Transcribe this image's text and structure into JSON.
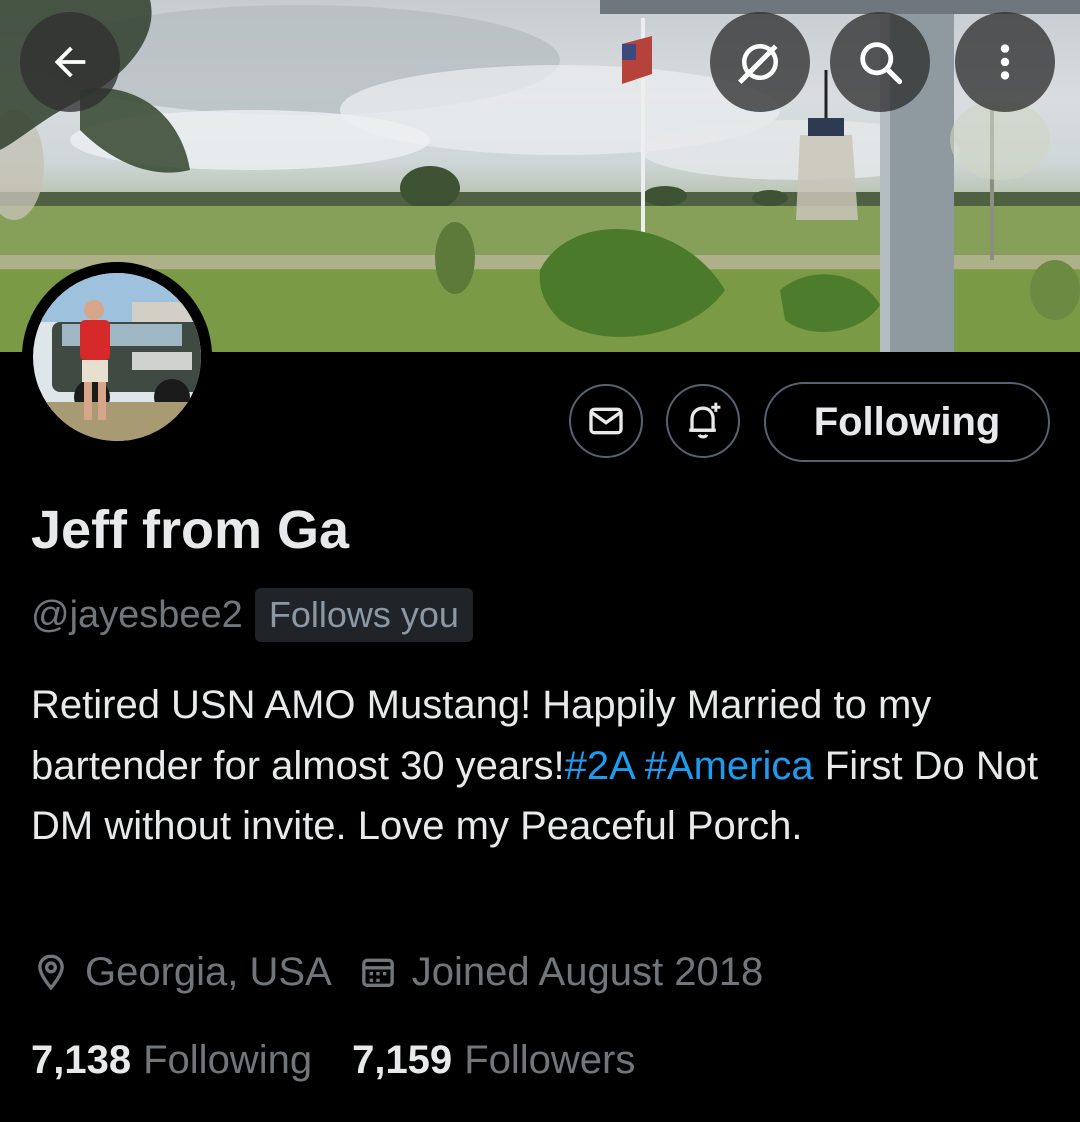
{
  "banner": {
    "description_icon": "banner-image"
  },
  "top_bar": {
    "back_icon": "arrow-left-icon",
    "grok_icon": "grok-icon",
    "search_icon": "search-icon",
    "more_icon": "more-vertical-icon"
  },
  "profile": {
    "display_name": "Jeff from Ga",
    "handle": "@jayesbee2",
    "follows_you_badge": "Follows you",
    "bio_part1": "Retired USN AMO Mustang! Happily Married to my bartender for almost 30 years!",
    "hashtag1": "#2A",
    "hashtag2": "#America",
    "bio_part2": "First Do Not DM without invite. Love my Peaceful Porch.",
    "location": "Georgia, USA",
    "joined": "Joined August 2018",
    "following_count": "7,138",
    "following_label": "Following",
    "followers_count": "7,159",
    "followers_label": "Followers"
  },
  "actions": {
    "message_icon": "mail-icon",
    "notify_icon": "bell-plus-icon",
    "following_button": "Following"
  },
  "colors": {
    "background": "#000000",
    "text_primary": "#e7e9ea",
    "text_secondary": "#71767b",
    "link": "#1d9bf0",
    "button_border": "#536471"
  }
}
